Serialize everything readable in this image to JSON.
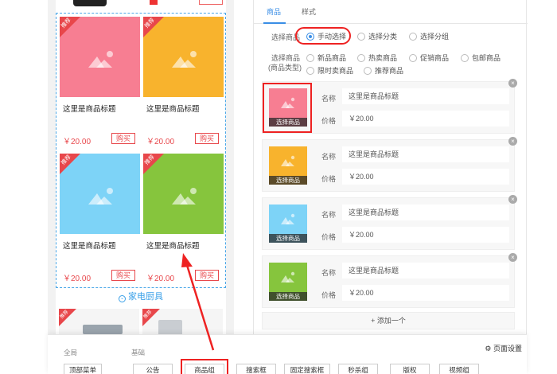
{
  "colors": {
    "accent": "#3a8ee6",
    "highlight": "#e22222",
    "price": "#e8474b",
    "pink": "#f77e92",
    "orange": "#f8b32d",
    "skyblue": "#7dd3f7",
    "green": "#86c53d"
  },
  "preview": {
    "goods": [
      {
        "ribbon": "推荐",
        "title": "这里是商品标题",
        "price": "￥20.00",
        "buy": "购买",
        "color": "#f77e92"
      },
      {
        "ribbon": "推荐",
        "title": "这里是商品标题",
        "price": "￥20.00",
        "buy": "购买",
        "color": "#f8b32d"
      },
      {
        "ribbon": "推荐",
        "title": "这里是商品标题",
        "price": "￥20.00",
        "buy": "购买",
        "color": "#7dd3f7"
      },
      {
        "ribbon": "推荐",
        "title": "这里是商品标题",
        "price": "￥20.00",
        "buy": "购买",
        "color": "#86c53d"
      }
    ],
    "category_label": "家电厨具",
    "bottom_ribbon": "推荐",
    "top_buy": "购买"
  },
  "settings": {
    "tabs": [
      "商品",
      "样式"
    ],
    "select_goods": {
      "label": "选择商品",
      "options": [
        {
          "label": "手动选择",
          "selected": true
        },
        {
          "label": "选择分类",
          "selected": false
        },
        {
          "label": "选择分组",
          "selected": false
        }
      ]
    },
    "goods_type": {
      "label": "选择商品",
      "label2": "(商品类型)",
      "options": [
        "新品商品",
        "热卖商品",
        "促销商品",
        "包邮商品",
        "限时卖商品",
        "推荐商品"
      ]
    },
    "cards": [
      {
        "select_label": "选择商品",
        "name_label": "名称",
        "name_value": "这里是商品标题",
        "price_label": "价格",
        "price_value": "￥20.00",
        "color": "#f77e92",
        "close": "×"
      },
      {
        "select_label": "选择商品",
        "name_label": "名称",
        "name_value": "这里是商品标题",
        "price_label": "价格",
        "price_value": "￥20.00",
        "color": "#f8b32d",
        "close": "×"
      },
      {
        "select_label": "选择商品",
        "name_label": "名称",
        "name_value": "这里是商品标题",
        "price_label": "价格",
        "price_value": "￥20.00",
        "color": "#7dd3f7",
        "close": "×"
      },
      {
        "select_label": "选择商品",
        "name_label": "名称",
        "name_value": "这里是商品标题",
        "price_label": "价格",
        "price_value": "￥20.00",
        "color": "#86c53d",
        "close": "×"
      }
    ],
    "add_label": "+ 添加一个"
  },
  "palette": {
    "global_label": "全局",
    "basic_label": "基础",
    "page_settings": "页面设置",
    "global_btn": "顶部菜单",
    "components": [
      "公告",
      "商品组",
      "搜索框",
      "固定搜索框",
      "秒杀组",
      "版权",
      "视频组"
    ]
  }
}
